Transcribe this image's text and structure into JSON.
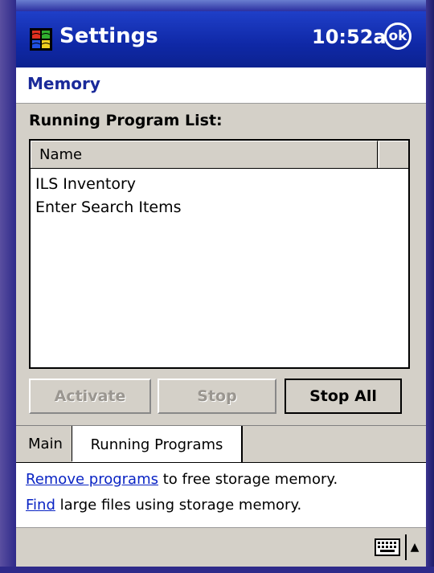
{
  "titlebar": {
    "app_title": "Settings",
    "clock": "10:52a",
    "ok_label": "ok",
    "start_icon": "windows-flag-icon"
  },
  "page": {
    "title": "Memory"
  },
  "running_programs": {
    "section_label": "Running Program List:",
    "column_name": "Name",
    "items": [
      "ILS Inventory",
      "Enter Search Items"
    ]
  },
  "buttons": {
    "activate": "Activate",
    "stop": "Stop",
    "stop_all": "Stop All"
  },
  "tabs": [
    {
      "label": "Main",
      "selected": false
    },
    {
      "label": "Running Programs",
      "selected": true
    }
  ],
  "links": {
    "remove_link": "Remove programs",
    "remove_rest": " to free storage memory.",
    "find_link": "Find",
    "find_rest": " large files using storage memory."
  },
  "menubar": {
    "keyboard_icon": "keyboard-icon",
    "sip_arrow": "▲"
  },
  "colors": {
    "titlebar": "#0f28a6",
    "page_title": "#1a2a9a",
    "link": "#0a24c4",
    "panel": "#d4d0c8"
  }
}
